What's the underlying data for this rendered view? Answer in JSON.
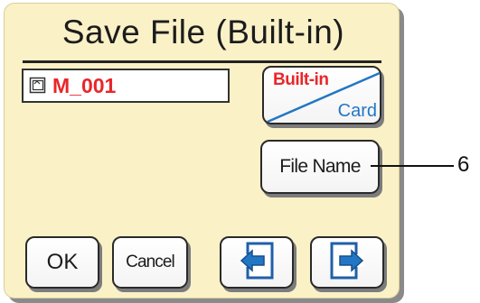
{
  "dialog": {
    "title": "Save File (Built-in)",
    "file_name_value": "M_001",
    "destination_button": {
      "top_label": "Built-in",
      "bottom_label": "Card"
    },
    "file_name_button_label": "File Name",
    "ok_label": "OK",
    "cancel_label": "Cancel",
    "prev_icon": "arrow-left-icon",
    "next_icon": "arrow-right-icon"
  },
  "callout": {
    "number": "6"
  },
  "colors": {
    "panel_background": "#faf1c7",
    "red_text": "#e8272a",
    "blue_accent": "#2277c4"
  }
}
